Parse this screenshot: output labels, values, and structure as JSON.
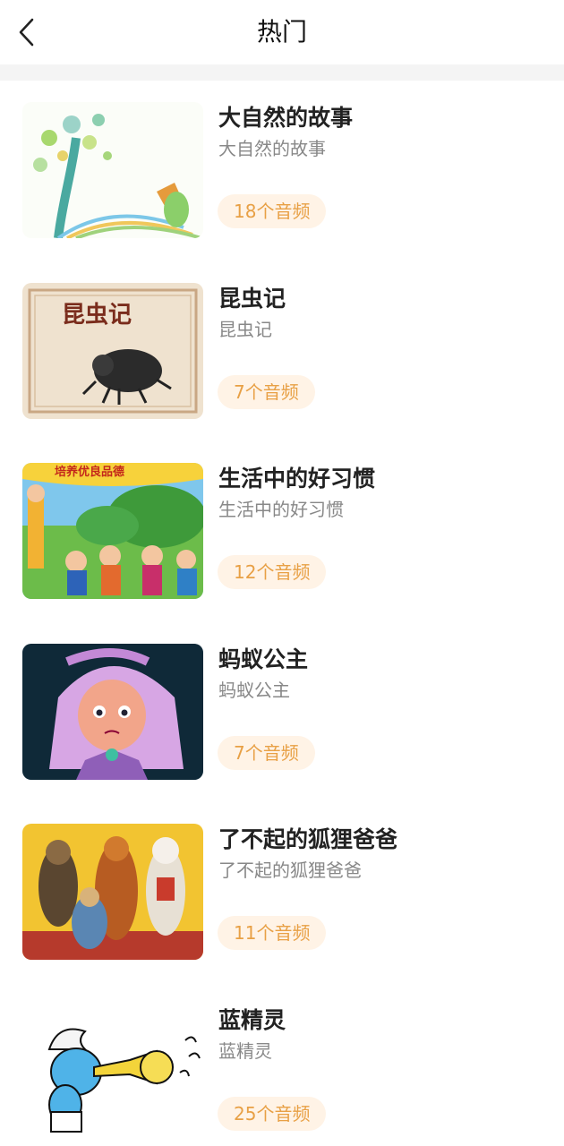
{
  "header": {
    "title": "热门"
  },
  "colors": {
    "badge_bg": "#fff3e6",
    "badge_text": "#e8a045"
  },
  "items": [
    {
      "title": "大自然的故事",
      "subtitle": "大自然的故事",
      "count": "18个音频",
      "cover": "nature-illustration"
    },
    {
      "title": "昆虫记",
      "subtitle": "昆虫记",
      "count": "7个音频",
      "cover": "beetle-book-cover",
      "cover_text": "昆虫记"
    },
    {
      "title": "生活中的好习惯",
      "subtitle": "生活中的好习惯",
      "count": "12个音频",
      "cover": "cartoon-kids-park",
      "cover_text": "培养优良品德"
    },
    {
      "title": "蚂蚁公主",
      "subtitle": "蚂蚁公主",
      "count": "7个音频",
      "cover": "cartoon-ant-princess"
    },
    {
      "title": "了不起的狐狸爸爸",
      "subtitle": "了不起的狐狸爸爸",
      "count": "11个音频",
      "cover": "fantastic-mr-fox-poster"
    },
    {
      "title": "蓝精灵",
      "subtitle": "蓝精灵",
      "count": "25个音频",
      "cover": "smurf-trumpet"
    }
  ]
}
